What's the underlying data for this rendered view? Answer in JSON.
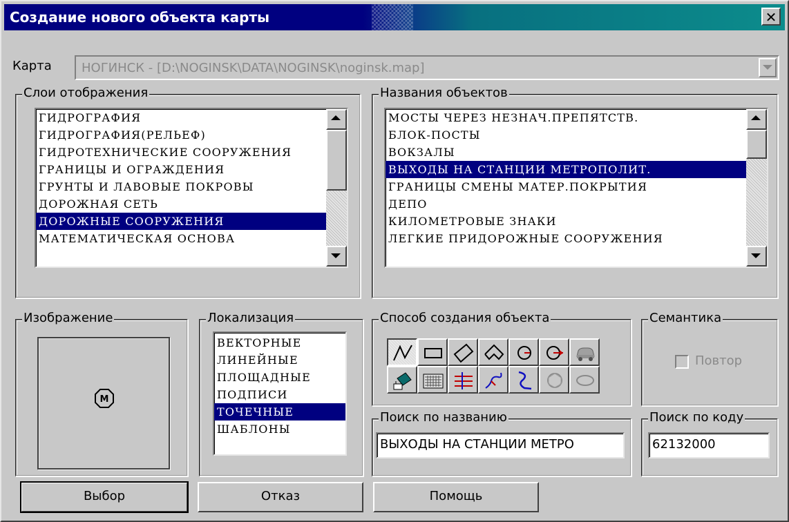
{
  "window": {
    "title": "Создание нового объекта карты",
    "close_glyph": "✕"
  },
  "map": {
    "label": "Карта",
    "value": "НОГИНСК - [D:\\NOGINSK\\DATA\\NOGINSK\\noginsk.map]"
  },
  "layers": {
    "legend": "Слои отображения",
    "items": [
      "ГИДРОГРАФИЯ",
      "ГИДРОГРАФИЯ(РЕЛЬЕФ)",
      "ГИДРОТЕХНИЧЕСКИЕ СООРУЖЕНИЯ",
      "ГРАНИЦЫ И ОГРАЖДЕНИЯ",
      "ГРУНТЫ И ЛАВОВЫЕ ПОКРОВЫ",
      "ДОРОЖНАЯ СЕТЬ",
      "ДОРОЖНЫЕ СООРУЖЕНИЯ",
      "МАТЕМАТИЧЕСКАЯ ОСНОВА"
    ],
    "selected": "ДОРОЖНЫЕ СООРУЖЕНИЯ"
  },
  "object_names": {
    "legend": "Названия объектов",
    "items": [
      " МОСТЫ ЧЕРЕЗ НЕЗНАЧ.ПРЕПЯТСТВ.",
      "БЛОК-ПОСТЫ",
      "ВОКЗАЛЫ",
      "ВЫХОДЫ НА СТАНЦИИ МЕТРОПОЛИТ.",
      "ГРАНИЦЫ СМЕНЫ МАТЕР.ПОКРЫТИЯ",
      "ДЕПО",
      "КИЛОМЕТРОВЫЕ ЗНАКИ",
      "ЛЕГКИЕ ПРИДОРОЖНЫЕ СООРУЖЕНИЯ"
    ],
    "selected": "ВЫХОДЫ НА СТАНЦИИ МЕТРОПОЛИТ."
  },
  "image": {
    "legend": "Изображение",
    "symbol_icon": "metro-symbol-icon",
    "symbol_text": "M"
  },
  "localization": {
    "legend": "Локализация",
    "items": [
      "ВЕКТОРНЫЕ",
      "ЛИНЕЙНЫЕ",
      "ПЛОЩАДНЫЕ",
      "ПОДПИСИ",
      "ТОЧЕЧНЫЕ",
      "ШАБЛОНЫ"
    ],
    "selected": "ТОЧЕЧНЫЕ"
  },
  "creation_method": {
    "legend": "Способ создания объекта",
    "tools_row1": [
      "polyline-icon",
      "rectangle-icon",
      "diamond-icon",
      "pentagon-icon",
      "circle-icon",
      "circle-arrow-icon",
      "car-icon"
    ],
    "tools_row2": [
      "paint-bucket-icon",
      "keyboard-icon",
      "parallel-lines-icon",
      "curve-blue-icon",
      "spline-icon",
      "polygon-circle-icon",
      "ellipse-icon"
    ],
    "active_tool": "polyline-icon"
  },
  "semantics": {
    "legend": "Семантика",
    "repeat_label": "Повтор",
    "repeat_checked": false
  },
  "search_name": {
    "legend": "Поиск  по названию",
    "value": "ВЫХОДЫ НА СТАНЦИИ МЕТРО"
  },
  "search_code": {
    "legend": "Поиск по коду",
    "value": "62132000"
  },
  "buttons": {
    "select": "Выбор",
    "cancel": "Отказ",
    "help": "Помощь"
  }
}
